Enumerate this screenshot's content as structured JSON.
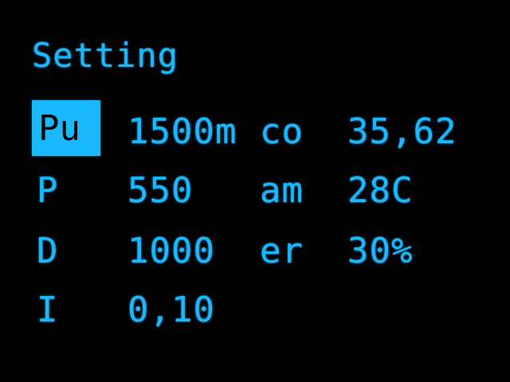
{
  "screen": {
    "title": "Setting",
    "text_color": "#1ab8ff",
    "background_color": "#000000",
    "selected_item": {
      "label": "Pu",
      "value": "1500m"
    },
    "rows": [
      {
        "label": "P",
        "value": "550"
      },
      {
        "label": "D",
        "value": "1000"
      },
      {
        "label": "I",
        "value": "0,10"
      }
    ],
    "readouts": [
      {
        "label": "co",
        "value": "35,62"
      },
      {
        "label": "am",
        "value": "28C"
      },
      {
        "label": "er",
        "value": "30%"
      }
    ]
  }
}
